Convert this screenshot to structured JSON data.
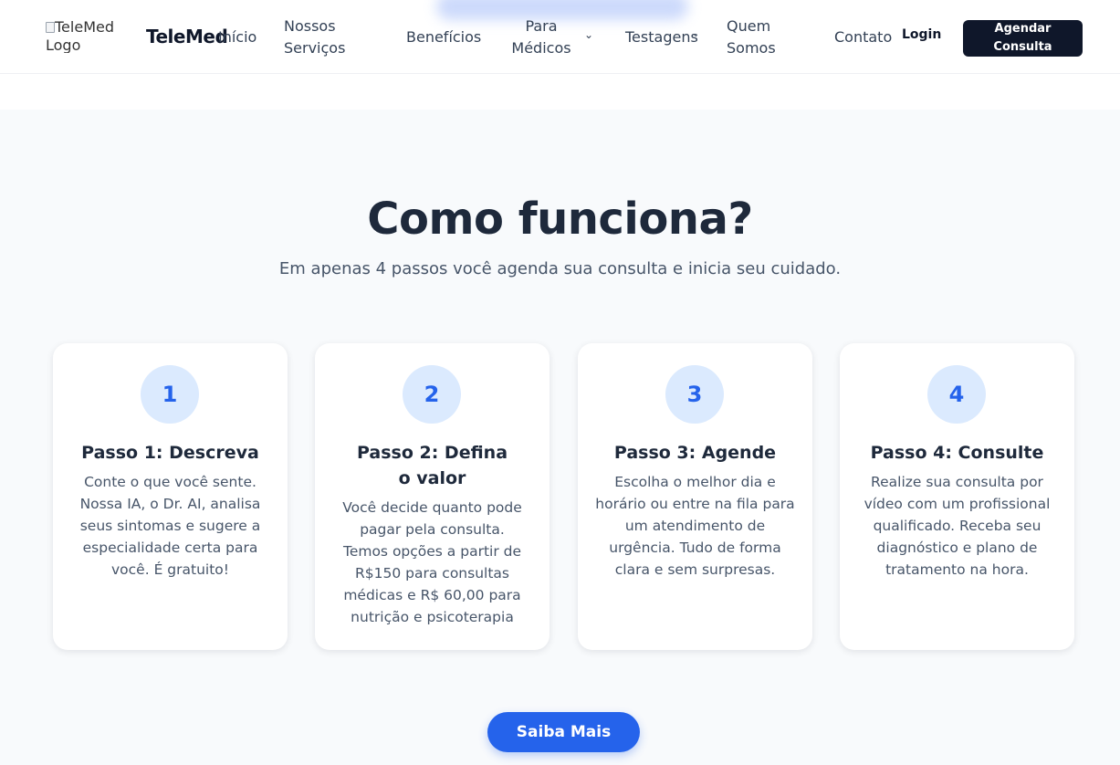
{
  "header": {
    "logo_alt": "TeleMed Logo",
    "brand": "TeleMed",
    "nav": {
      "inicio": "Início",
      "servicos": "Nossos Serviços",
      "beneficios": "Benefícios",
      "medicos": "Para Médicos",
      "testagens": "Testagens",
      "quem_somos": "Quem Somos",
      "contato": "Contato"
    },
    "login": "Login",
    "cta": "Agendar Consulta"
  },
  "section": {
    "title": "Como funciona?",
    "subtitle": "Em apenas 4 passos você agenda sua consulta e inicia seu cuidado.",
    "steps": [
      {
        "number": "1",
        "title": "Passo 1: Descreva",
        "text": "Conte o que você sente. Nossa IA, o Dr. AI, analisa seus sintomas e sugere a especialidade certa para você. É gratuito!"
      },
      {
        "number": "2",
        "title": "Passo 2: Defina o valor",
        "text": "Você decide quanto pode pagar pela consulta. Temos opções a partir de R$150 para consultas médicas e R$ 60,00 para nutrição e psicoterapia"
      },
      {
        "number": "3",
        "title": "Passo 3: Agende",
        "text": "Escolha o melhor dia e horário ou entre na fila para um atendimento de urgência. Tudo de forma clara e sem surpresas."
      },
      {
        "number": "4",
        "title": "Passo 4: Consulte",
        "text": "Realize sua consulta por vídeo com um profissional qualificado. Receba seu diagnóstico e plano de tratamento na hora."
      }
    ],
    "button": "Saiba Mais"
  },
  "colors": {
    "accent": "#2563eb",
    "dark": "#0f172a",
    "circle_bg": "#dbeafe"
  },
  "icons": {
    "dropdown": "chevron-down-icon"
  }
}
